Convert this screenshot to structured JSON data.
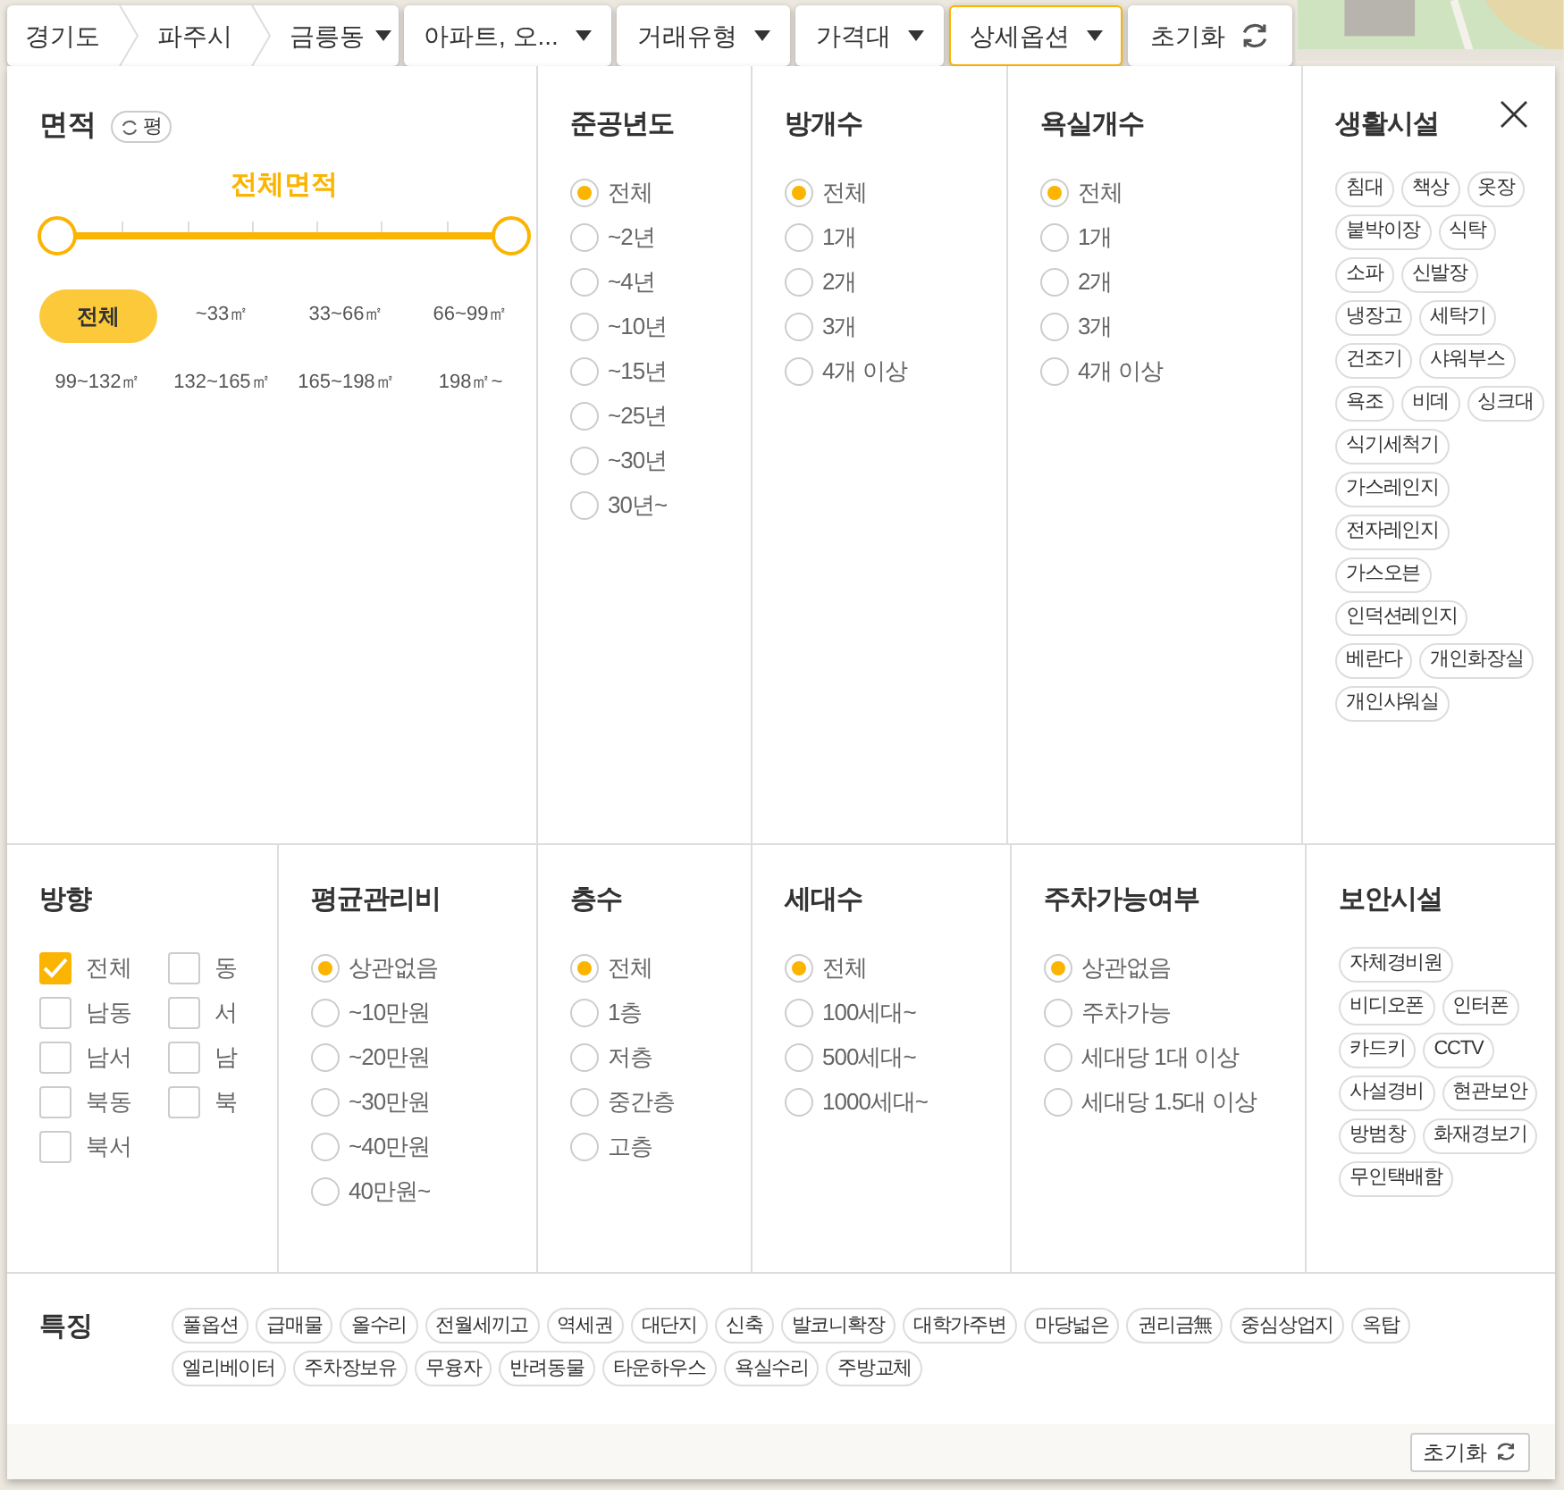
{
  "top_bar": {
    "breadcrumb": [
      {
        "label": "경기도",
        "dropdown": false
      },
      {
        "label": "파주시",
        "dropdown": false
      },
      {
        "label": "금릉동",
        "dropdown": true
      }
    ],
    "filters": [
      {
        "label": "아파트, 오...",
        "selected": false
      },
      {
        "label": "거래유형",
        "selected": false
      },
      {
        "label": "가격대",
        "selected": false
      },
      {
        "label": "상세옵션",
        "selected": true
      }
    ],
    "reset": "초기화"
  },
  "top_sections": [
    {
      "kind": "area",
      "title": "면적",
      "unit": "평",
      "range_label": "전체면적",
      "low": {
        "level": 0
      },
      "high": {
        "level": 1
      },
      "chips": [
        {
          "label": "전체",
          "selected": true
        },
        {
          "label": "~33㎡",
          "selected": false
        },
        {
          "label": "33~66㎡",
          "selected": false
        },
        {
          "label": "66~99㎡",
          "selected": false
        },
        {
          "label": "99~132㎡",
          "selected": false
        },
        {
          "label": "132~165㎡",
          "selected": false
        },
        {
          "label": "165~198㎡",
          "selected": false
        },
        {
          "label": "198㎡~",
          "selected": false
        }
      ]
    },
    {
      "kind": "radio",
      "title": "준공년도",
      "options": [
        {
          "label": "전체",
          "selected": true
        },
        {
          "label": "~2년",
          "selected": false
        },
        {
          "label": "~4년",
          "selected": false
        },
        {
          "label": "~10년",
          "selected": false
        },
        {
          "label": "~15년",
          "selected": false
        },
        {
          "label": "~25년",
          "selected": false
        },
        {
          "label": "~30년",
          "selected": false
        },
        {
          "label": "30년~",
          "selected": false
        }
      ]
    },
    {
      "kind": "radio",
      "title": "방개수",
      "options": [
        {
          "label": "전체",
          "selected": true
        },
        {
          "label": "1개",
          "selected": false
        },
        {
          "label": "2개",
          "selected": false
        },
        {
          "label": "3개",
          "selected": false
        },
        {
          "label": "4개 이상",
          "selected": false
        }
      ]
    },
    {
      "kind": "radio",
      "title": "욕실개수",
      "options": [
        {
          "label": "전체",
          "selected": true
        },
        {
          "label": "1개",
          "selected": false
        },
        {
          "label": "2개",
          "selected": false
        },
        {
          "label": "3개",
          "selected": false
        },
        {
          "label": "4개 이상",
          "selected": false
        }
      ]
    },
    {
      "kind": "tags",
      "title": "생활시설",
      "tags": [
        "침대",
        "책상",
        "옷장",
        "붙박이장",
        "식탁",
        "소파",
        "신발장",
        "냉장고",
        "세탁기",
        "건조기",
        "샤워부스",
        "욕조",
        "비데",
        "싱크대",
        "식기세척기",
        "가스레인지",
        "전자레인지",
        "가스오븐",
        "인덕션레인지",
        "베란다",
        "개인화장실",
        "개인샤워실"
      ]
    }
  ],
  "bottom_sections": [
    {
      "kind": "checkbox",
      "title": "방향",
      "options": [
        {
          "label": "전체",
          "checked": true
        },
        {
          "label": "동",
          "checked": false
        },
        {
          "label": "남동",
          "checked": false
        },
        {
          "label": "서",
          "checked": false
        },
        {
          "label": "남서",
          "checked": false
        },
        {
          "label": "남",
          "checked": false
        },
        {
          "label": "북동",
          "checked": false
        },
        {
          "label": "북",
          "checked": false
        },
        {
          "label": "북서",
          "checked": false
        }
      ]
    },
    {
      "kind": "radio",
      "title": "평균관리비",
      "options": [
        {
          "label": "상관없음",
          "selected": true
        },
        {
          "label": "~10만원",
          "selected": false
        },
        {
          "label": "~20만원",
          "selected": false
        },
        {
          "label": "~30만원",
          "selected": false
        },
        {
          "label": "~40만원",
          "selected": false
        },
        {
          "label": "40만원~",
          "selected": false
        }
      ]
    },
    {
      "kind": "radio",
      "title": "층수",
      "options": [
        {
          "label": "전체",
          "selected": true
        },
        {
          "label": "1층",
          "selected": false
        },
        {
          "label": "저층",
          "selected": false
        },
        {
          "label": "중간층",
          "selected": false
        },
        {
          "label": "고층",
          "selected": false
        }
      ]
    },
    {
      "kind": "radio",
      "title": "세대수",
      "options": [
        {
          "label": "전체",
          "selected": true
        },
        {
          "label": "100세대~",
          "selected": false
        },
        {
          "label": "500세대~",
          "selected": false
        },
        {
          "label": "1000세대~",
          "selected": false
        }
      ]
    },
    {
      "kind": "radio",
      "title": "주차가능여부",
      "options": [
        {
          "label": "상관없음",
          "selected": true
        },
        {
          "label": "주차가능",
          "selected": false
        },
        {
          "label": "세대당 1대 이상",
          "selected": false
        },
        {
          "label": "세대당 1.5대 이상",
          "selected": false
        }
      ]
    },
    {
      "kind": "tags",
      "title": "보안시설",
      "tags": [
        "자체경비원",
        "비디오폰",
        "인터폰",
        "카드키",
        "CCTV",
        "사설경비",
        "현관보안",
        "방범창",
        "화재경보기",
        "무인택배함"
      ]
    }
  ],
  "features": {
    "title": "특징",
    "tags": [
      "풀옵션",
      "급매물",
      "올수리",
      "전월세끼고",
      "역세권",
      "대단지",
      "신축",
      "발코니확장",
      "대학가주변",
      "마당넓은",
      "권리금無",
      "중심상업지",
      "옥탑",
      "엘리베이터",
      "주차장보유",
      "무융자",
      "반려동물",
      "타운하우스",
      "욕실수리",
      "주방교체"
    ]
  },
  "footer": {
    "reset": "초기화"
  }
}
